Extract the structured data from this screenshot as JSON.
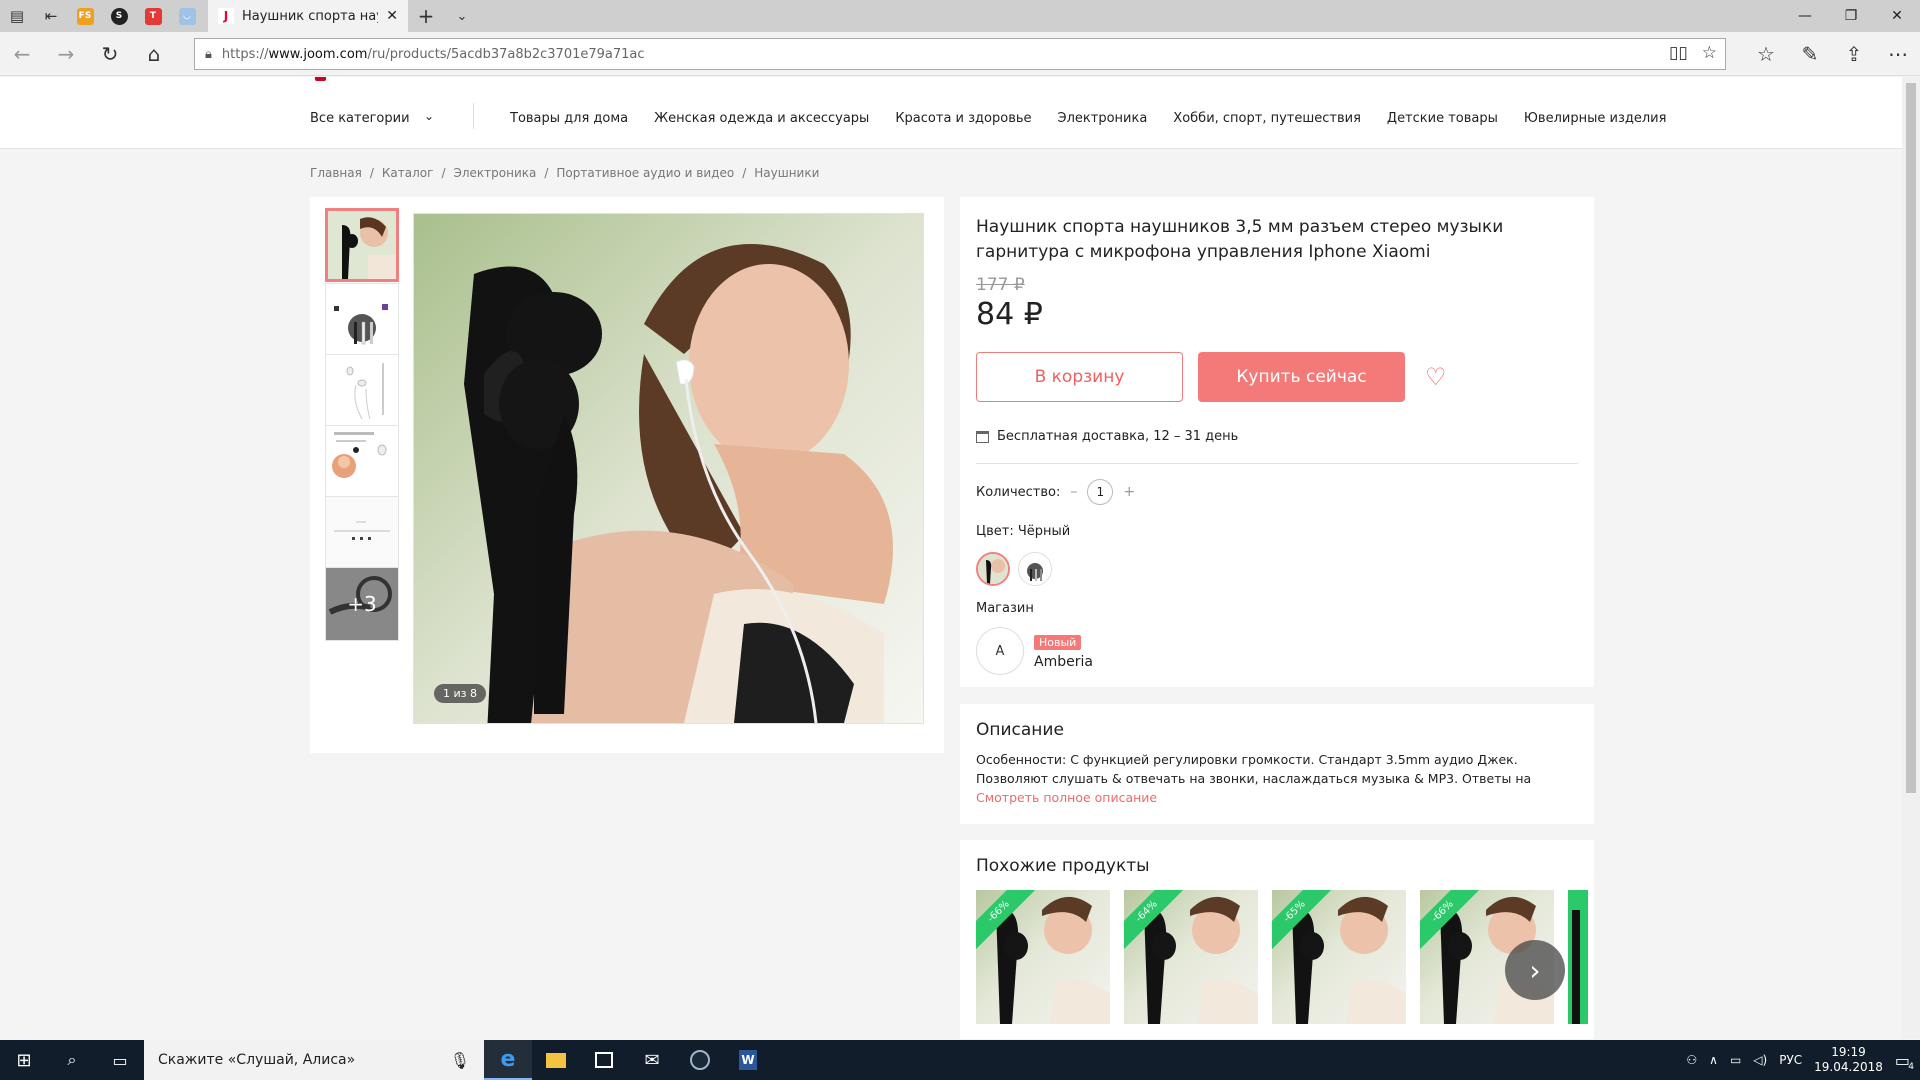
{
  "browser": {
    "tab_title": "Наушник спорта науш",
    "url_scheme": "https://",
    "url_domain": "www.joom.com",
    "url_path": "/ru/products/5acdb37a8b2c3701e79a71ac"
  },
  "categories": {
    "all_label": "Все категории",
    "items": [
      "Товары для дома",
      "Женская одежда и аксессуары",
      "Красота и здоровье",
      "Электроника",
      "Хобби, спорт, путешествия",
      "Детские товары",
      "Ювелирные изделия"
    ]
  },
  "breadcrumbs": [
    "Главная",
    "/",
    "Каталог",
    "/",
    "Электроника",
    "/",
    "Портативное аудио и видео",
    "/",
    "Наушники"
  ],
  "gallery": {
    "more_label": "+3",
    "counter": "1 из 8"
  },
  "product": {
    "title": "Наушник спорта наушников 3,5 мм разъем стерео музыки гарнитура с микрофона управления Iphone Xiaomi",
    "old_price": "177 ₽",
    "price": "84 ₽",
    "cart_label": "В корзину",
    "buy_label": "Купить сейчас",
    "delivery": "Бесплатная доставка, 12 – 31 день",
    "qty_label": "Количество:",
    "qty_minus": "–",
    "qty_value": "1",
    "qty_plus": "+",
    "color_label": "Цвет: Чёрный",
    "shop_label": "Магазин",
    "shop_initial": "A",
    "shop_badge": "Новый",
    "shop_name": "Amberia"
  },
  "description": {
    "heading": "Описание",
    "text": "Особенности: С функцией регулировки громкости. Стандарт 3.5mm аудио Джек. Позволяют слушать & отвечать на звонки, наслаждаться музыка & MP3. Ответы на вызовы и вызовы",
    "more_link": "Смотреть полное описание"
  },
  "similar": {
    "heading": "Похожие продукты",
    "items": [
      {
        "discount": "-66%"
      },
      {
        "discount": "-64%"
      },
      {
        "discount": "-65%"
      },
      {
        "discount": "-66%"
      }
    ]
  },
  "taskbar": {
    "search_text": "Скажите «Слушай, Алиса»",
    "lang": "РУС",
    "time": "19:19",
    "date": "19.04.2018",
    "notif_count": "4"
  },
  "colors": {
    "accent": "#f47a7a",
    "discount": "#2cc96b"
  }
}
